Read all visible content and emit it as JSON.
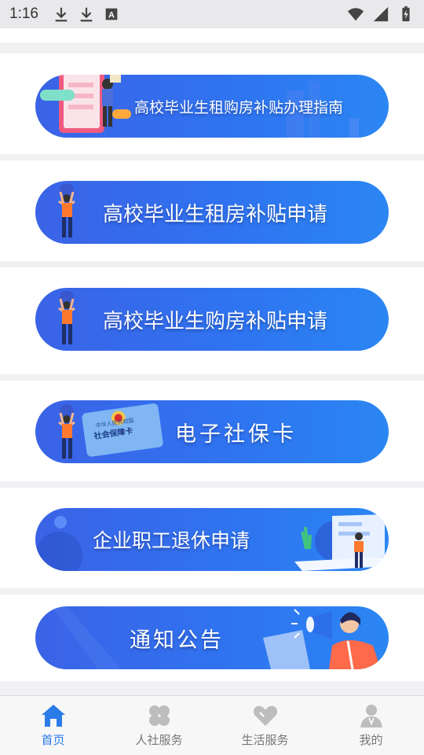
{
  "status_bar": {
    "time": "1:16",
    "icons_left": [
      "download-icon",
      "download-icon",
      "a-box-icon"
    ],
    "icons_right": [
      "wifi-icon",
      "signal-icon",
      "battery-charging-icon"
    ]
  },
  "banners": [
    {
      "label": "高校毕业生租购房补贴办理指南",
      "style": "guide"
    },
    {
      "label": "高校毕业生租房补贴申请",
      "style": "person"
    },
    {
      "label": "高校毕业生购房补贴申请",
      "style": "person"
    },
    {
      "label": "电子社保卡",
      "style": "card",
      "card_text": "社会保障卡",
      "card_subtext": "中华人民共和国"
    },
    {
      "label": "企业职工退休申请",
      "style": "laptop"
    },
    {
      "label": "通知公告",
      "style": "megaphone"
    }
  ],
  "bottom_nav": {
    "items": [
      {
        "label": "首页",
        "icon": "home-icon",
        "active": true
      },
      {
        "label": "人社服务",
        "icon": "clover-icon",
        "active": false
      },
      {
        "label": "生活服务",
        "icon": "heart-icon",
        "active": false
      },
      {
        "label": "我的",
        "icon": "user-icon",
        "active": false
      }
    ],
    "active_color": "#2b7be9",
    "inactive_color": "#bdbdbd"
  },
  "colors": {
    "banner_gradient_start": "#3b63e6",
    "banner_gradient_end": "#2b86f3",
    "page_background": "#f1f1f3"
  }
}
